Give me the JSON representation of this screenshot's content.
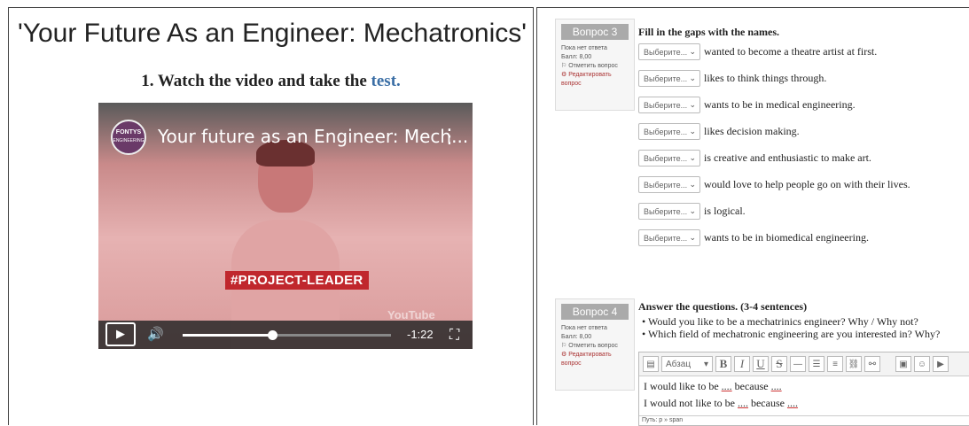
{
  "left": {
    "lesson_title": "'Your Future As an Engineer: Mechatronics'",
    "task_prefix": "1. Watch the video and take the",
    "task_link": "test.",
    "video": {
      "channel_logo_top": "FONTYS",
      "channel_logo_bottom": "ENGINEERING",
      "title": "Your future as an Engineer: Mech...",
      "tag": "#PROJECT-LEADER",
      "watermark": "YouTube",
      "time_remaining": "-1:22",
      "progress": 0.43,
      "icons": {
        "more": "more-vert-icon",
        "play": "play-icon",
        "volume": "volume-icon",
        "fullscreen": "fullscreen-icon"
      }
    }
  },
  "q3": {
    "number": "Вопрос 3",
    "status": "Пока нет ответа",
    "score": "Балл: 8,00",
    "flag": "Отметить вопрос",
    "edit": "Редактировать вопрос",
    "prompt": "Fill in the gaps with the names.",
    "select_placeholder": "Выберите...",
    "gaps": [
      "wanted to become a theatre artist at first.",
      "likes to think things through.",
      "wants to be in medical engineering.",
      "likes decision making.",
      "is creative and enthusiastic to make art.",
      "would love to help people go on with their lives.",
      "is logical.",
      "wants to be in biomedical engineering."
    ]
  },
  "q4": {
    "number": "Вопрос 4",
    "status": "Пока нет ответа",
    "score": "Балл: 8,00",
    "flag": "Отметить вопрос",
    "edit": "Редактировать вопрос",
    "prompt": "Answer the questions. (3-4 sentences)",
    "bullets": [
      "Would you like to be a mechatrinics engineer? Why / Why not?",
      "Which field of mechatronic engineering are you interested in? Why?"
    ],
    "editor": {
      "format": "Абзац",
      "line1_a": "I would like to be",
      "line1_b": "because",
      "line2_a": "I would not like to be",
      "line2_b": "because",
      "blank": "....",
      "path": "Путь: p » span"
    }
  }
}
